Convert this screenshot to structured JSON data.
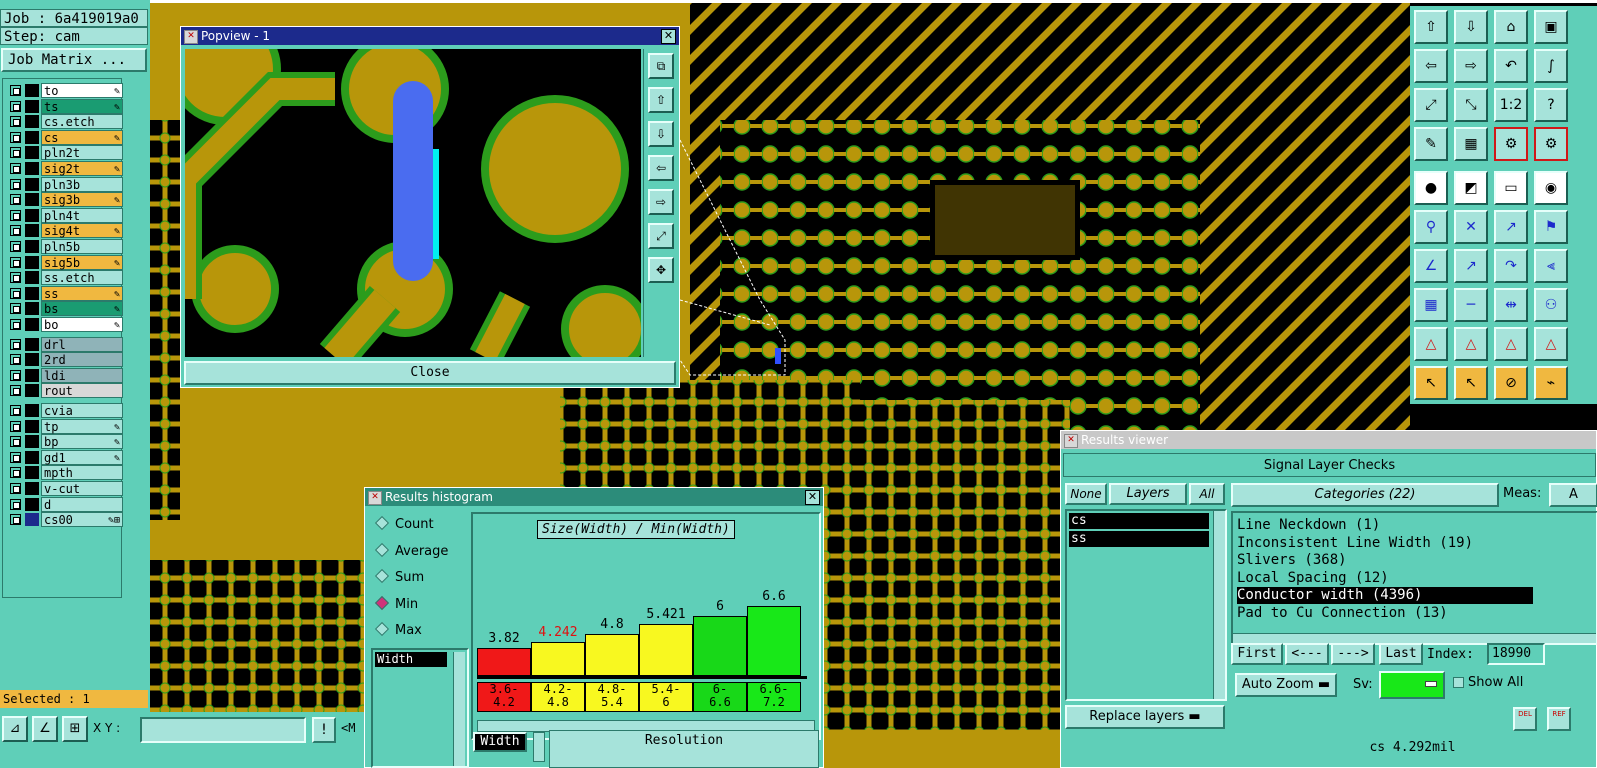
{
  "job": {
    "label": "Job : 6a419019a0",
    "step": "Step: cam",
    "matrix_button": "Job Matrix ..."
  },
  "layers": [
    {
      "name": "to",
      "color": "#ffffff",
      "row_color": "#ffffff",
      "pen": "✎"
    },
    {
      "name": "ts",
      "color": "#1a9c72",
      "row_color": "#1a9c72",
      "pen": "✎"
    },
    {
      "name": "cs.etch",
      "color": "#a6e3da",
      "row_color": "#a6e3da",
      "pen": ""
    },
    {
      "name": "cs",
      "color": "#f0b840",
      "row_color": "#f0b840",
      "pen": "✎"
    },
    {
      "name": "pln2t",
      "color": "#a6e3da",
      "row_color": "#a6e3da",
      "pen": ""
    },
    {
      "name": "sig2t",
      "color": "#f0b840",
      "row_color": "#f0b840",
      "pen": "✎"
    },
    {
      "name": "pln3b",
      "color": "#a6e3da",
      "row_color": "#a6e3da",
      "pen": ""
    },
    {
      "name": "sig3b",
      "color": "#f0b840",
      "row_color": "#f0b840",
      "pen": "✎"
    },
    {
      "name": "pln4t",
      "color": "#a6e3da",
      "row_color": "#a6e3da",
      "pen": ""
    },
    {
      "name": "sig4t",
      "color": "#f0b840",
      "row_color": "#f0b840",
      "pen": "✎"
    },
    {
      "name": "pln5b",
      "color": "#a6e3da",
      "row_color": "#a6e3da",
      "pen": ""
    },
    {
      "name": "sig5b",
      "color": "#f0b840",
      "row_color": "#f0b840",
      "pen": "✎"
    },
    {
      "name": "ss.etch",
      "color": "#a6e3da",
      "row_color": "#a6e3da",
      "pen": ""
    },
    {
      "name": "ss",
      "color": "#f0b840",
      "row_color": "#f0b840",
      "pen": "✎"
    },
    {
      "name": "bs",
      "color": "#1a9c72",
      "row_color": "#1a9c72",
      "pen": "✎"
    },
    {
      "name": "bo",
      "color": "#ffffff",
      "row_color": "#ffffff",
      "pen": "✎"
    },
    {
      "name": "drl",
      "color": "#8fb3b8",
      "row_color": "#8fb3b8",
      "pen": ""
    },
    {
      "name": "2rd",
      "color": "#8fb3b8",
      "row_color": "#8fb3b8",
      "pen": ""
    },
    {
      "name": "ldi",
      "color": "#8fb3b8",
      "row_color": "#8fb3b8",
      "pen": ""
    },
    {
      "name": "rout",
      "color": "#d8d8d8",
      "row_color": "#d8d8d8",
      "pen": ""
    },
    {
      "name": "cvia",
      "color": "#a6e3da",
      "row_color": "#a6e3da",
      "pen": ""
    },
    {
      "name": "tp",
      "color": "#a6e3da",
      "row_color": "#a6e3da",
      "pen": "✎"
    },
    {
      "name": "bp",
      "color": "#a6e3da",
      "row_color": "#a6e3da",
      "pen": "✎"
    },
    {
      "name": "gd1",
      "color": "#a6e3da",
      "row_color": "#a6e3da",
      "pen": "✎"
    },
    {
      "name": "mpth",
      "color": "#a6e3da",
      "row_color": "#a6e3da",
      "pen": ""
    },
    {
      "name": "v-cut",
      "color": "#a6e3da",
      "row_color": "#a6e3da",
      "pen": ""
    },
    {
      "name": "d",
      "color": "#a6e3da",
      "row_color": "#a6e3da",
      "pen": ""
    },
    {
      "name": "cs00",
      "color": "#a6e3da",
      "row_color": "#a6e3da",
      "pen": "✎⊞"
    }
  ],
  "selected_label": "Selected : 1",
  "xy": {
    "label": "X Y :",
    "value": "",
    "warn": "!",
    "extra": "<M"
  },
  "popview": {
    "title": "Popview - 1",
    "close_label": "Close"
  },
  "histogram": {
    "title": "Results histogram",
    "modes": [
      {
        "label": "Count",
        "on": false
      },
      {
        "label": "Average",
        "on": false
      },
      {
        "label": "Sum",
        "on": false
      },
      {
        "label": "Min",
        "on": true
      },
      {
        "label": "Max",
        "on": false
      }
    ],
    "list_item": "Width",
    "chart_title": "Size(Width) / Min(Width)",
    "footer_left": "Width",
    "footer_right": "Resolution"
  },
  "chart_data": {
    "type": "bar",
    "title": "Size(Width) / Min(Width)",
    "categories": [
      "3.6-4.2",
      "4.2-4.8",
      "4.8-5.4",
      "5.4-6",
      "6-6.6",
      "6.6-7.2"
    ],
    "bin_lines": [
      [
        "3.6-",
        "4.2"
      ],
      [
        "4.2-",
        "4.8"
      ],
      [
        "4.8-",
        "5.4"
      ],
      [
        "5.4-",
        "6"
      ],
      [
        "6-",
        "6.6"
      ],
      [
        "6.6-",
        "7.2"
      ]
    ],
    "values": [
      3.82,
      4.242,
      4.8,
      5.421,
      6,
      6.6
    ],
    "value_labels": [
      "3.82",
      "4.242",
      "4.8",
      "5.421",
      "6",
      "6.6"
    ],
    "colors": [
      "#f01818",
      "#f8f820",
      "#f8f820",
      "#f8f820",
      "#18d818",
      "#18e818"
    ],
    "label_colors": [
      "#000000",
      "#e01010",
      "#000000",
      "#000000",
      "#000000",
      "#000000"
    ],
    "ylim": [
      0,
      7.2
    ]
  },
  "results": {
    "title": "Results viewer",
    "heading": "Signal Layer Checks",
    "none_label": "None",
    "layers_label": "Layers",
    "all_label": "All",
    "layer_items": [
      "cs",
      "ss"
    ],
    "categories_label": "Categories (22)",
    "meas_label": "Meas:",
    "meas_value": "A",
    "categories": [
      {
        "label": "Line Neckdown (1)",
        "selected": false
      },
      {
        "label": "Inconsistent Line Width (19)",
        "selected": false
      },
      {
        "label": "Slivers (368)",
        "selected": false
      },
      {
        "label": "Local Spacing (12)",
        "selected": false
      },
      {
        "label": "Conductor width (4396)",
        "selected": true
      },
      {
        "label": "Pad to Cu Connection (13)",
        "selected": false
      }
    ],
    "first_label": "First",
    "prev_label": "<---",
    "next_label": "--->",
    "last_label": "Last",
    "index_label": "Index:",
    "index_value": "18990",
    "autozoom_label": "Auto Zoom",
    "sv_label": "Sv:",
    "show_all_label": "Show All",
    "replace_label": "Replace layers",
    "status": "cs 4.292mil",
    "del_label": "DEL",
    "ref_label": "REF"
  },
  "icons": {
    "toolbar": [
      "⇧",
      "⇩",
      "⌂",
      "▣",
      "⇦",
      "⇨",
      "↶",
      "∫",
      "⤢",
      "⤡",
      "1:2",
      "?",
      "✎",
      "▦",
      "⚙",
      "⚙",
      "●",
      "◩",
      "▭",
      "◉",
      "⚲",
      "✕",
      "↗",
      "⚑",
      "∠",
      "↗",
      "↷",
      "⫷",
      "▦",
      "─",
      "⇹",
      "⚇",
      "△",
      "△",
      "△",
      "△",
      "↖",
      "↖",
      "⊘",
      "⌁"
    ]
  },
  "colors": {
    "panel": "#5fcfb8",
    "panel_light": "#a6e3da",
    "copper": "#b8960a",
    "solder": "#2c9c1c",
    "title_blue": "#1c2a8c"
  }
}
